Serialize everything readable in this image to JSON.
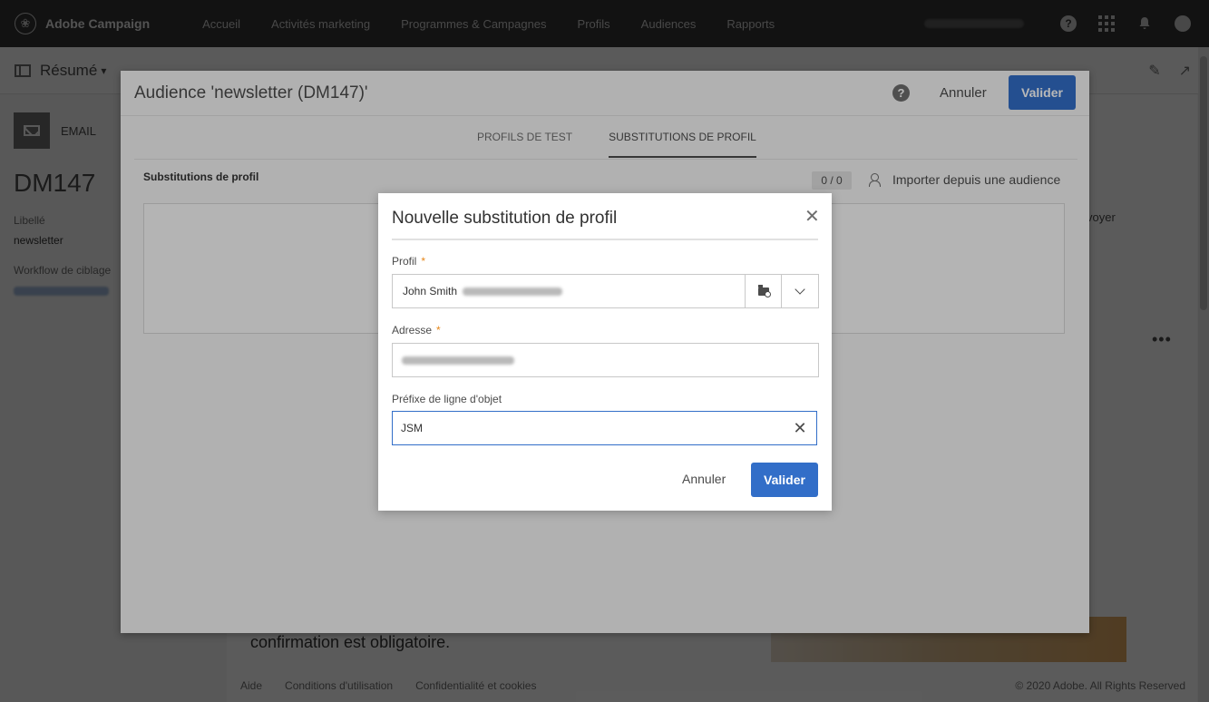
{
  "app": {
    "brand": "Adobe Campaign",
    "nav": [
      "Accueil",
      "Activités marketing",
      "Programmes & Campagnes",
      "Profils",
      "Audiences",
      "Rapports"
    ]
  },
  "background": {
    "view_label": "Résumé",
    "email_tab": "EMAIL",
    "dm_code": "DM147",
    "label_title": "Libellé",
    "label_value": "newsletter",
    "workflow_title": "Workflow de ciblage",
    "envoyer_text": "voyer",
    "body_text": "confirmation est obligatoire.",
    "footer": {
      "help": "Aide",
      "terms": "Conditions d'utilisation",
      "privacy": "Confidentialité et cookies",
      "copyright": "© 2020 Adobe. All Rights Reserved"
    }
  },
  "audience_dialog": {
    "title": "Audience 'newsletter (DM147)'",
    "cancel_label": "Annuler",
    "validate_label": "Valider",
    "tabs": [
      {
        "label": "PROFILS DE TEST",
        "active": false
      },
      {
        "label": "SUBSTITUTIONS DE PROFIL",
        "active": true
      }
    ],
    "section_title": "Substitutions de profil",
    "counter": "0 / 0",
    "import_label": "Importer depuis une audience"
  },
  "substitution_dialog": {
    "title": "Nouvelle substitution de profil",
    "profile_label": "Profil",
    "profile_value": "John Smith",
    "address_label": "Adresse",
    "prefix_label": "Préfixe de ligne d'objet",
    "prefix_value": "JSM",
    "required_marker": "*",
    "cancel_label": "Annuler",
    "validate_label": "Valider"
  },
  "colors": {
    "accent": "#326ec8",
    "topbar": "#323232",
    "required": "#e68619"
  }
}
